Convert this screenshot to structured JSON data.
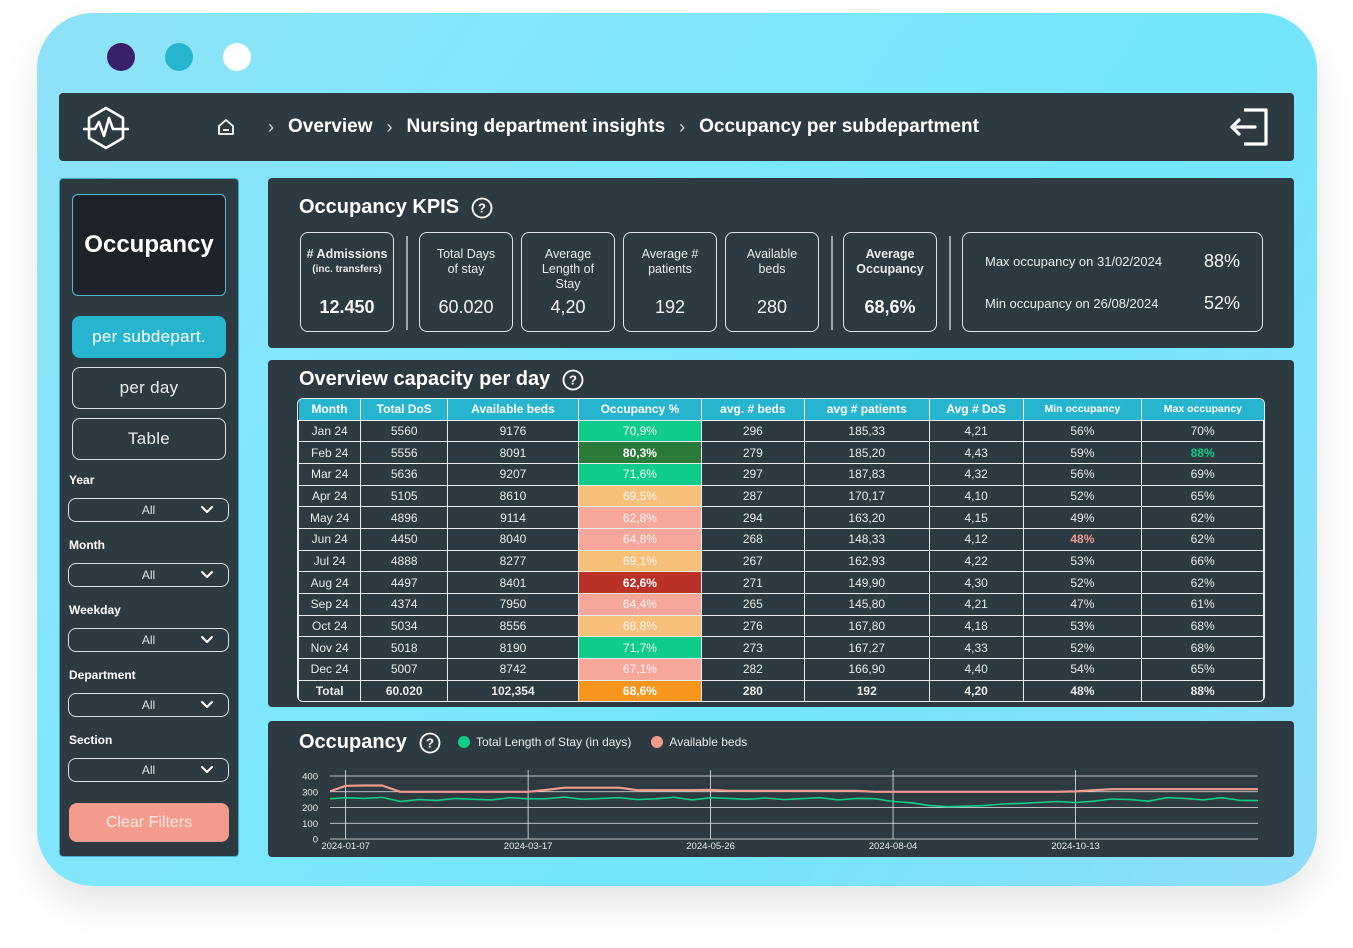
{
  "window": {
    "dots": [
      "#3a1f6b",
      "#27b4cf",
      "#ffffff"
    ]
  },
  "breadcrumb": {
    "items": [
      "Overview",
      "Nursing department insights",
      "Occupancy per subdepartment"
    ]
  },
  "sidebar": {
    "tile": "Occupancy",
    "nav": [
      {
        "label": "per subdepart.",
        "active": true
      },
      {
        "label": "per day",
        "active": false
      },
      {
        "label": "Table",
        "active": false
      }
    ],
    "filters": [
      {
        "label": "Year",
        "value": "All"
      },
      {
        "label": "Month",
        "value": "All"
      },
      {
        "label": "Weekday",
        "value": "All"
      },
      {
        "label": "Department",
        "value": "All"
      },
      {
        "label": "Section",
        "value": "All"
      }
    ],
    "clear_label": "Clear Filters"
  },
  "kpis": {
    "title": "Occupancy KPIS",
    "cards": [
      {
        "label": "# Admissions",
        "sub": "(inc. transfers)",
        "value": "12.450"
      },
      {
        "label": "Total Days of stay",
        "value": "60.020"
      },
      {
        "label": "Average Length of Stay",
        "value": "4,20"
      },
      {
        "label": "Average # patients",
        "value": "192"
      },
      {
        "label": "Available beds",
        "value": "280"
      },
      {
        "label": "Average Occupancy",
        "value": "68,6%"
      }
    ],
    "max": {
      "label": "Max occupancy  on 31/02/2024",
      "value": "88%"
    },
    "min": {
      "label": "Min occupancy  on 26/08/2024",
      "value": "52%"
    }
  },
  "capacity": {
    "title": "Overview capacity per day",
    "headers": [
      "Month",
      "Total DoS",
      "Available beds",
      "Occupancy %",
      "avg. # beds",
      "avg # patients",
      "Avg # DoS",
      "Min occupancy",
      "Max occupancy"
    ],
    "rows": [
      [
        "Jan 24",
        "5560",
        "9176",
        "70,9%",
        "296",
        "185,33",
        "4,21",
        "56%",
        "70%"
      ],
      [
        "Feb 24",
        "5556",
        "8091",
        "80,3%",
        "279",
        "185,20",
        "4,43",
        "59%",
        "88%"
      ],
      [
        "Mar 24",
        "5636",
        "9207",
        "71,6%",
        "297",
        "187,83",
        "4,32",
        "56%",
        "69%"
      ],
      [
        "Apr 24",
        "5105",
        "8610",
        "69,5%",
        "287",
        "170,17",
        "4,10",
        "52%",
        "65%"
      ],
      [
        "May 24",
        "4896",
        "9114",
        "62,8%",
        "294",
        "163,20",
        "4,15",
        "49%",
        "62%"
      ],
      [
        "Jun 24",
        "4450",
        "8040",
        "64,8%",
        "268",
        "148,33",
        "4,12",
        "48%",
        "62%"
      ],
      [
        "Jul 24",
        "4888",
        "8277",
        "69,1%",
        "267",
        "162,93",
        "4,22",
        "53%",
        "66%"
      ],
      [
        "Aug 24",
        "4497",
        "8401",
        "62,6%",
        "271",
        "149,90",
        "4,30",
        "52%",
        "62%"
      ],
      [
        "Sep 24",
        "4374",
        "7950",
        "64,4%",
        "265",
        "145,80",
        "4,21",
        "47%",
        "61%"
      ],
      [
        "Oct 24",
        "5034",
        "8556",
        "68,8%",
        "276",
        "167,80",
        "4,18",
        "53%",
        "68%"
      ],
      [
        "Nov 24",
        "5018",
        "8190",
        "71,7%",
        "273",
        "167,27",
        "4,33",
        "52%",
        "68%"
      ],
      [
        "Dec 24",
        "5007",
        "8742",
        "67,1%",
        "282",
        "166,90",
        "4,40",
        "54%",
        "65%"
      ]
    ],
    "total": [
      "Total",
      "60.020",
      "102,354",
      "68,6%",
      "280",
      "192",
      "4,20",
      "48%",
      "88%"
    ],
    "occ_colors": [
      "#10cc8a",
      "#2a7a3a",
      "#10cc8a",
      "#f7c07a",
      "#f7a79a",
      "#f7a79a",
      "#f7c07a",
      "#b93127",
      "#f7a79a",
      "#f7c07a",
      "#10cc8a",
      "#f7a79a"
    ],
    "total_occ_color": "#f8951f",
    "highlight": {
      "max_color": "#10cc8a",
      "min_color": "#f39c8e"
    }
  },
  "chart_data": {
    "type": "line",
    "title": "Occupancy",
    "ylim": [
      0,
      400
    ],
    "yticks": [
      0,
      100,
      200,
      300,
      400
    ],
    "xtick_labels": [
      "2024-01-07",
      "2024-03-17",
      "2024-05-26",
      "2024-08-04",
      "2024-10-13"
    ],
    "x": [
      "2024-01-01",
      "2024-01-07",
      "2024-01-14",
      "2024-01-21",
      "2024-01-28",
      "2024-02-04",
      "2024-02-11",
      "2024-02-18",
      "2024-02-25",
      "2024-03-03",
      "2024-03-10",
      "2024-03-17",
      "2024-03-24",
      "2024-03-31",
      "2024-04-07",
      "2024-04-14",
      "2024-04-21",
      "2024-04-28",
      "2024-05-05",
      "2024-05-12",
      "2024-05-19",
      "2024-05-26",
      "2024-06-02",
      "2024-06-09",
      "2024-06-16",
      "2024-06-23",
      "2024-06-30",
      "2024-07-07",
      "2024-07-14",
      "2024-07-21",
      "2024-07-28",
      "2024-08-04",
      "2024-08-11",
      "2024-08-18",
      "2024-08-25",
      "2024-09-01",
      "2024-09-08",
      "2024-09-15",
      "2024-09-22",
      "2024-09-29",
      "2024-10-06",
      "2024-10-13",
      "2024-10-20",
      "2024-10-27",
      "2024-11-03",
      "2024-11-10",
      "2024-11-17",
      "2024-11-24",
      "2024-12-01",
      "2024-12-08",
      "2024-12-15",
      "2024-12-22"
    ],
    "series": [
      {
        "name": "Total Length of Stay (in days)",
        "color": "#10cc8a",
        "values": [
          255,
          262,
          258,
          264,
          238,
          250,
          245,
          258,
          252,
          248,
          262,
          255,
          256,
          266,
          252,
          258,
          262,
          250,
          255,
          265,
          248,
          262,
          258,
          252,
          260,
          250,
          256,
          262,
          248,
          258,
          256,
          238,
          230,
          212,
          205,
          208,
          212,
          222,
          226,
          232,
          238,
          232,
          240,
          254,
          250,
          240,
          262,
          258,
          248,
          262,
          246,
          244
        ]
      },
      {
        "name": "Available beds",
        "color": "#f39c8e",
        "values": [
          302,
          338,
          340,
          340,
          300,
          300,
          300,
          300,
          300,
          300,
          300,
          300,
          312,
          326,
          326,
          326,
          326,
          310,
          310,
          310,
          310,
          312,
          306,
          306,
          306,
          306,
          306,
          306,
          306,
          306,
          300,
          300,
          300,
          300,
          300,
          300,
          300,
          300,
          300,
          300,
          300,
          302,
          310,
          316,
          316,
          316,
          316,
          316,
          316,
          316,
          316,
          316
        ]
      }
    ]
  }
}
